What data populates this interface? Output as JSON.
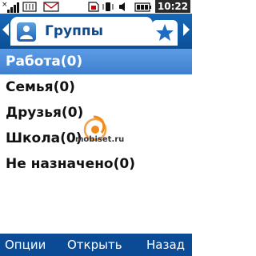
{
  "statusbar": {
    "time": "10:22",
    "icons": [
      "signal-icon",
      "data-icon",
      "message-icon",
      "sim-icon",
      "vibrate-icon",
      "battery-icon"
    ]
  },
  "header": {
    "title": "Группы",
    "tab_icon": "contacts-icon",
    "tab2_icon": "star-icon"
  },
  "list": {
    "items": [
      {
        "label": "Работа(0)",
        "selected": true
      },
      {
        "label": "Семья(0)",
        "selected": false
      },
      {
        "label": "Друзья(0)",
        "selected": false
      },
      {
        "label": "Школа(0)",
        "selected": false
      },
      {
        "label": "Не назначено(0)",
        "selected": false
      }
    ]
  },
  "watermark": {
    "text": "mobiset.ru"
  },
  "softkeys": {
    "left": "Опции",
    "center": "Открыть",
    "right": "Назад"
  },
  "colors": {
    "header": "#0d5aa7",
    "selected": "#4d8ddb",
    "softkeys": "#0b4a94"
  }
}
